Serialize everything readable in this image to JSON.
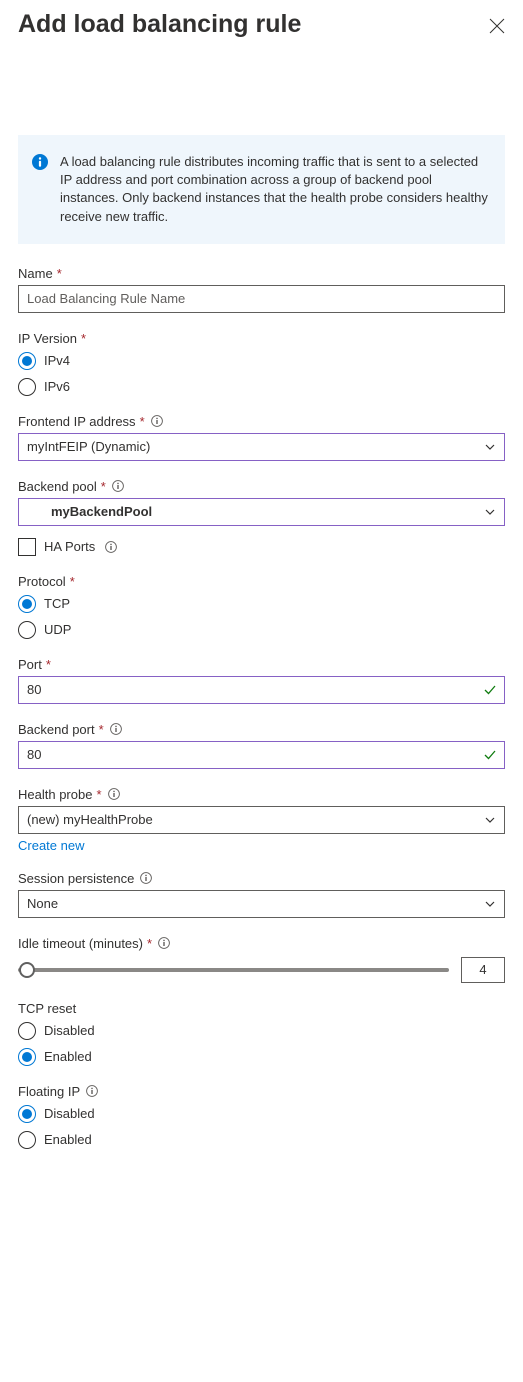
{
  "header": {
    "title": "Add load balancing rule"
  },
  "infoBox": {
    "text": "A load balancing rule distributes incoming traffic that is sent to a selected IP address and port combination across a group of backend pool instances. Only backend instances that the health probe considers healthy receive new traffic."
  },
  "fields": {
    "name": {
      "label": "Name",
      "placeholder": "Load Balancing Rule Name",
      "value": ""
    },
    "ipVersion": {
      "label": "IP Version",
      "options": {
        "ipv4": "IPv4",
        "ipv6": "IPv6"
      },
      "selected": "ipv4"
    },
    "frontendIp": {
      "label": "Frontend IP address",
      "value": "myIntFEIP (Dynamic)"
    },
    "backendPool": {
      "label": "Backend pool",
      "value": "myBackendPool"
    },
    "haPorts": {
      "label": "HA Ports",
      "checked": false
    },
    "protocol": {
      "label": "Protocol",
      "options": {
        "tcp": "TCP",
        "udp": "UDP"
      },
      "selected": "tcp"
    },
    "port": {
      "label": "Port",
      "value": "80"
    },
    "backendPort": {
      "label": "Backend port",
      "value": "80"
    },
    "healthProbe": {
      "label": "Health probe",
      "value": "(new) myHealthProbe",
      "createNew": "Create new"
    },
    "sessionPersistence": {
      "label": "Session persistence",
      "value": "None"
    },
    "idleTimeout": {
      "label": "Idle timeout (minutes)",
      "value": "4"
    },
    "tcpReset": {
      "label": "TCP reset",
      "options": {
        "disabled": "Disabled",
        "enabled": "Enabled"
      },
      "selected": "enabled"
    },
    "floatingIp": {
      "label": "Floating IP",
      "options": {
        "disabled": "Disabled",
        "enabled": "Enabled"
      },
      "selected": "disabled"
    }
  }
}
